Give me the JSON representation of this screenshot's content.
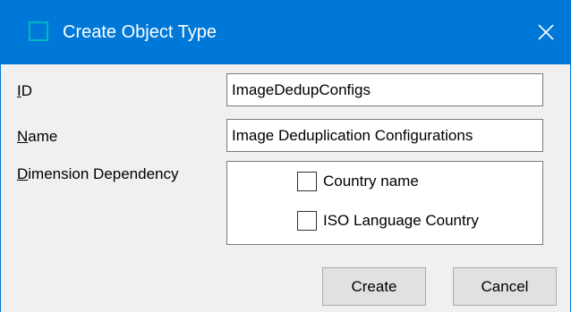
{
  "window": {
    "title": "Create Object Type",
    "accent_color": "#0078d7",
    "icon": "app-window-icon",
    "close_icon": "close-icon"
  },
  "form": {
    "id": {
      "label_prefix": "",
      "label_access_key": "I",
      "label_rest": "D",
      "value": "ImageDedupConfigs"
    },
    "name": {
      "label_access_key": "N",
      "label_rest": "ame",
      "value": "Image Deduplication Configurations"
    },
    "dimension_dependency": {
      "label_access_key": "D",
      "label_rest": "imension Dependency",
      "options": [
        {
          "label": "Country name",
          "checked": false
        },
        {
          "label": "ISO Language Country",
          "checked": false
        }
      ]
    }
  },
  "buttons": {
    "create_label": "Create",
    "cancel_label": "Cancel"
  }
}
